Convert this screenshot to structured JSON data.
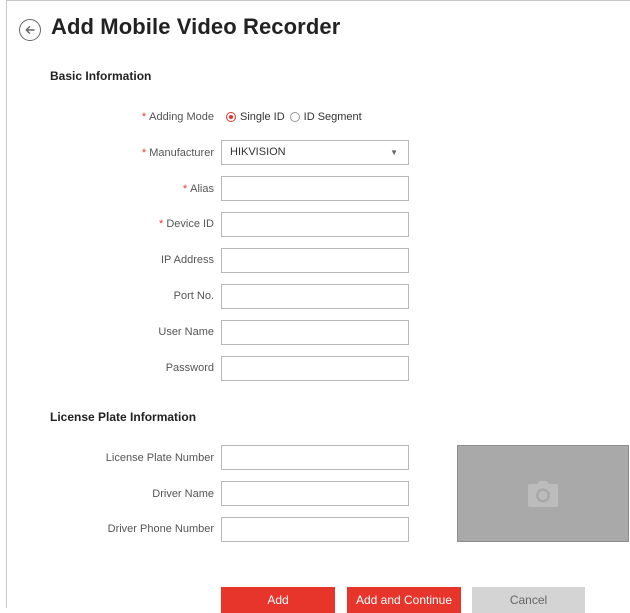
{
  "header": {
    "title": "Add Mobile Video Recorder"
  },
  "basic": {
    "section_title": "Basic Information",
    "adding_mode": {
      "label": "Adding Mode",
      "options": [
        "Single ID",
        "ID Segment"
      ],
      "selected": "Single ID"
    },
    "manufacturer": {
      "label": "Manufacturer",
      "value": "HIKVISION"
    },
    "alias": {
      "label": "Alias",
      "value": ""
    },
    "device_id": {
      "label": "Device ID",
      "value": ""
    },
    "ip_address": {
      "label": "IP Address",
      "value": ""
    },
    "port": {
      "label": "Port No.",
      "value": ""
    },
    "user_name": {
      "label": "User Name",
      "value": ""
    },
    "password": {
      "label": "Password",
      "value": ""
    },
    "required_mark": "*"
  },
  "license": {
    "section_title": "License Plate Information",
    "plate_number": {
      "label": "License Plate Number",
      "value": ""
    },
    "driver_name": {
      "label": "Driver Name",
      "value": ""
    },
    "driver_phone": {
      "label": "Driver Phone Number",
      "value": ""
    }
  },
  "actions": {
    "add": "Add",
    "add_continue": "Add and Continue",
    "cancel": "Cancel"
  },
  "colors": {
    "accent": "#e8352c",
    "disabled": "#d4d4d4",
    "photo_placeholder": "#a9a9a9"
  },
  "icons": {
    "back": "back-arrow-icon",
    "dropdown": "chevron-down-icon",
    "photo": "camera-icon"
  }
}
